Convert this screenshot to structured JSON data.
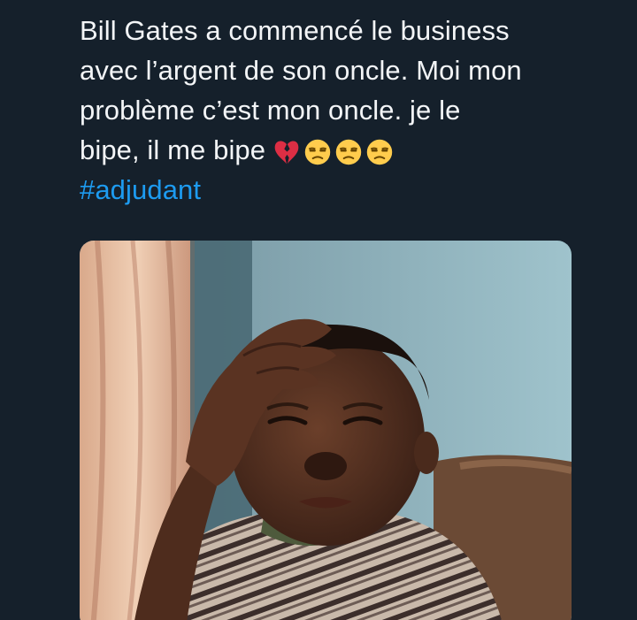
{
  "tweet": {
    "lines": [
      "Bill Gates a commencé le business",
      "avec l’argent de son oncle. Moi mon",
      "problème c’est mon oncle. je le",
      "bipe, il me bipe"
    ],
    "emojis": [
      "broken-heart-emoji",
      "unamused-face-emoji",
      "unamused-face-emoji",
      "unamused-face-emoji"
    ],
    "hashtag": "#adjudant"
  },
  "colors": {
    "background": "#15202b",
    "text": "#f3f5f7",
    "link": "#1d9bf0"
  },
  "media": {
    "type": "photo",
    "icon": "photo-of-boy-holding-forehead"
  }
}
